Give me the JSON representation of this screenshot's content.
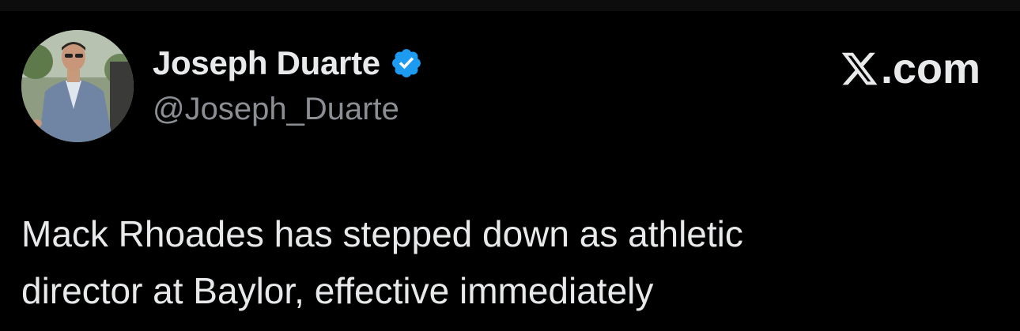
{
  "author": {
    "display_name": "Joseph Duarte",
    "handle": "@Joseph_Duarte",
    "verified_icon": "verified-badge-icon",
    "avatar": "profile-photo"
  },
  "brand": {
    "icon": "x-logo-icon",
    "suffix": ".com"
  },
  "tweet": {
    "lines": [
      "Mack Rhoades has stepped down as athletic",
      "director at Baylor, effective immediately"
    ]
  },
  "colors": {
    "background": "#000000",
    "text": "#e7e9ea",
    "muted": "#8b8f94",
    "verified": "#1d9bf0"
  }
}
